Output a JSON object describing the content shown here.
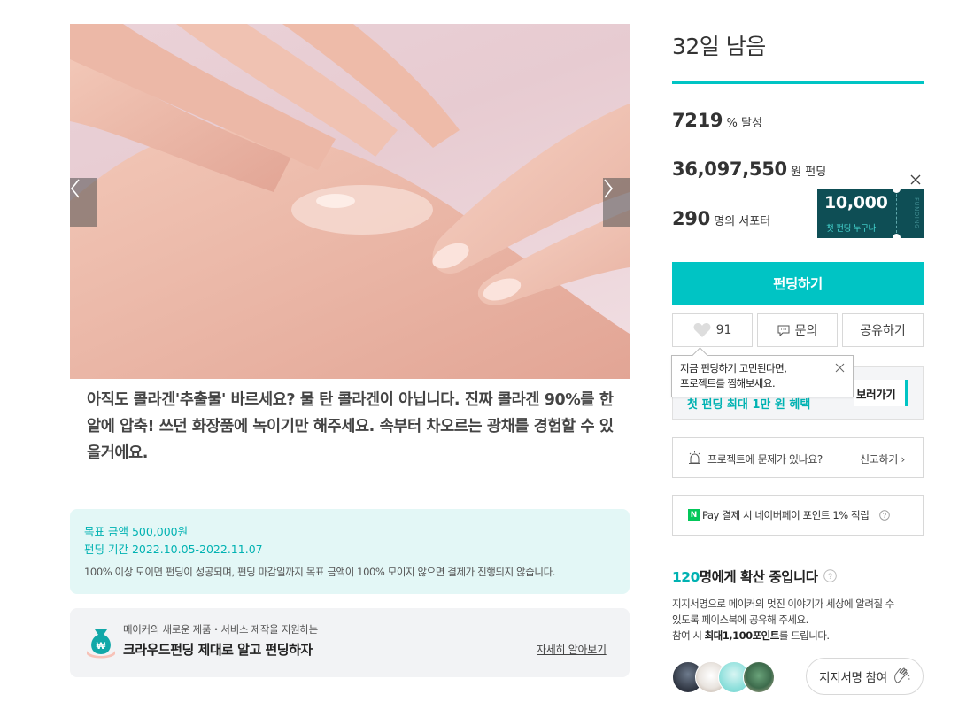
{
  "hero": {
    "image": "hand-with-collagen-gel-photo",
    "prev_icon": "chevron-left-icon",
    "next_icon": "chevron-right-icon"
  },
  "intro_text": "아직도 콜라겐'추출물' 바르세요? 물 탄 콜라겐이 아닙니다. 진짜 콜라겐 90%를 한 알에 압축! 쓰던 화장품에 녹이기만 해주세요. 속부터 차오르는 광채를 경험할 수 있을거에요.",
  "goal": {
    "amount": "목표 금액 500,000원",
    "period": "펀딩 기간 2022.10.05-2022.11.07",
    "note": "100% 이상 모이면 펀딩이 성공되며, 펀딩 마감일까지 목표 금액이 100% 모이지 않으면 결제가 진행되지 않습니다."
  },
  "crowd": {
    "sub": "메이커의 새로운 제품・서비스 제작을 지원하는",
    "title": "크라우드펀딩 제대로 알고 펀딩하자",
    "link": "자세히 알아보기"
  },
  "status": {
    "days_left": "32일 남음",
    "percent_num": "7219",
    "percent_unit": "% 달성",
    "amount_num": "36,097,550",
    "amount_unit": "원 펀딩",
    "supporters_num": "290",
    "supporters_unit": "명의 서포터"
  },
  "coupon": {
    "amount": "10,000",
    "label": "첫 펀딩 누구나",
    "side": "FUNDING"
  },
  "actions": {
    "fund": "펀딩하기",
    "like_count": "91",
    "inquiry": "문의",
    "share": "공유하기"
  },
  "tooltip": {
    "line1": "지금 펀딩하기 고민된다면,",
    "line2": "프로젝트를 찜해보세요."
  },
  "benefit": {
    "text": "첫 펀딩 최대 1만 원 혜택",
    "button": "보러가기"
  },
  "report": {
    "text": "프로젝트에 문제가 있나요?",
    "link": "신고하기 ›"
  },
  "npay": {
    "logo": "N",
    "text": "Pay 결제 시 네이버페이 포인트 1% 적립"
  },
  "spread": {
    "count": "120",
    "title": "명에게 확산 중입니다",
    "desc_line1": "지지서명으로 메이커의 멋진 이야기가 세상에 알려질 수",
    "desc_line2": "있도록 페이스북에 공유해 주세요.",
    "desc_line3_pre": "참여 시 ",
    "desc_line3_bold": "최대1,100포인트",
    "desc_line3_post": "를 드립니다.",
    "sign_button": "지지서명 참여"
  },
  "colors": {
    "accent": "#00c4c4",
    "coupon_bg": "#0e4e55",
    "goal_bg": "#e3f7f6",
    "npay_green": "#03c75a"
  }
}
